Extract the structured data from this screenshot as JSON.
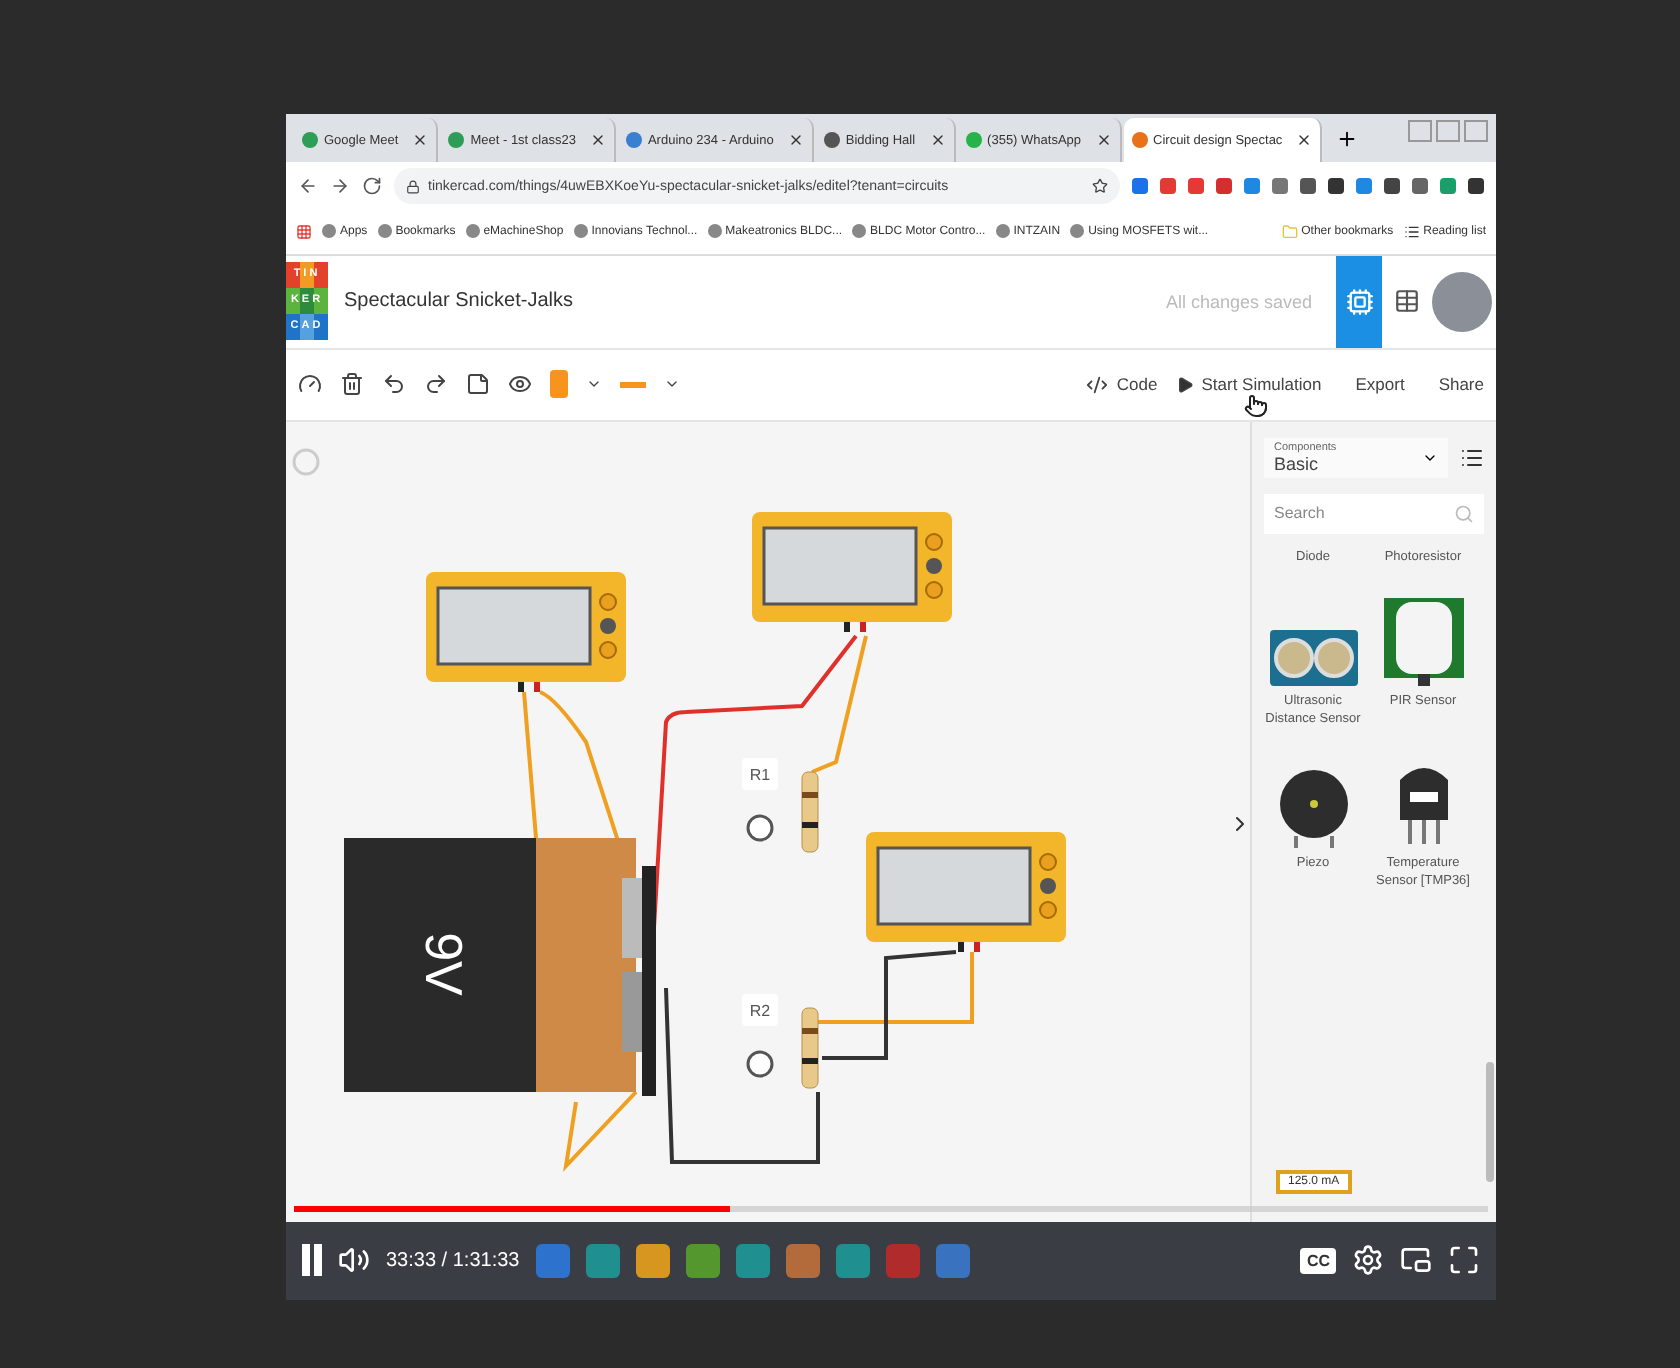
{
  "browser": {
    "tabs": [
      {
        "title": "Google Meet",
        "color": "#2e9d57",
        "selected": false
      },
      {
        "title": "Meet - 1st class23",
        "color": "#2e9d57",
        "selected": false
      },
      {
        "title": "Arduino 234 - Arduino",
        "color": "#3b7fd0",
        "selected": false
      },
      {
        "title": "Bidding Hall",
        "color": "#555555",
        "selected": false
      },
      {
        "title": "(355) WhatsApp",
        "color": "#25b34a",
        "selected": false
      },
      {
        "title": "Circuit design Spectac",
        "color": "#e8711a",
        "selected": true
      }
    ],
    "url": "tinkercad.com/things/4uwEBXKoeYu-spectacular-snicket-jalks/editel?tenant=circuits",
    "bookmarks": [
      "Apps",
      "Bookmarks",
      "eMachineShop",
      "Innovians Technol...",
      "Makeatronics BLDC...",
      "BLDC Motor Contro...",
      "INTZAIN",
      "Using MOSFETS wit..."
    ],
    "other_bookmarks": "Other bookmarks",
    "reading_list": "Reading list"
  },
  "app": {
    "logo_rows": [
      "TIN",
      "KER",
      "CAD"
    ],
    "title": "Spectacular Snicket-Jalks",
    "save_status": "All changes saved",
    "toolbar": {
      "code": "Code",
      "start_simulation": "Start Simulation",
      "export": "Export",
      "share": "Share"
    }
  },
  "canvas": {
    "battery": {
      "label": "9V"
    },
    "resistors": [
      {
        "label": "R1"
      },
      {
        "label": "R2"
      }
    ]
  },
  "components_panel": {
    "label": "Components",
    "category": "Basic",
    "search": {
      "placeholder": "Search"
    },
    "items": [
      {
        "name": "Diode",
        "kind": "label_only"
      },
      {
        "name": "Photoresistor",
        "kind": "label_only"
      },
      {
        "name": "Ultrasonic Distance Sensor",
        "kind": "ultrasonic"
      },
      {
        "name": "PIR Sensor",
        "kind": "pir"
      },
      {
        "name": "Piezo",
        "kind": "piezo"
      },
      {
        "name": "Temperature Sensor [TMP36]",
        "kind": "tmp"
      }
    ],
    "reading": "125.0 mA"
  },
  "video": {
    "playing": true,
    "progress": {
      "level": 0.365
    },
    "time": "33:33 / 1:31:33",
    "captions": "CC"
  }
}
